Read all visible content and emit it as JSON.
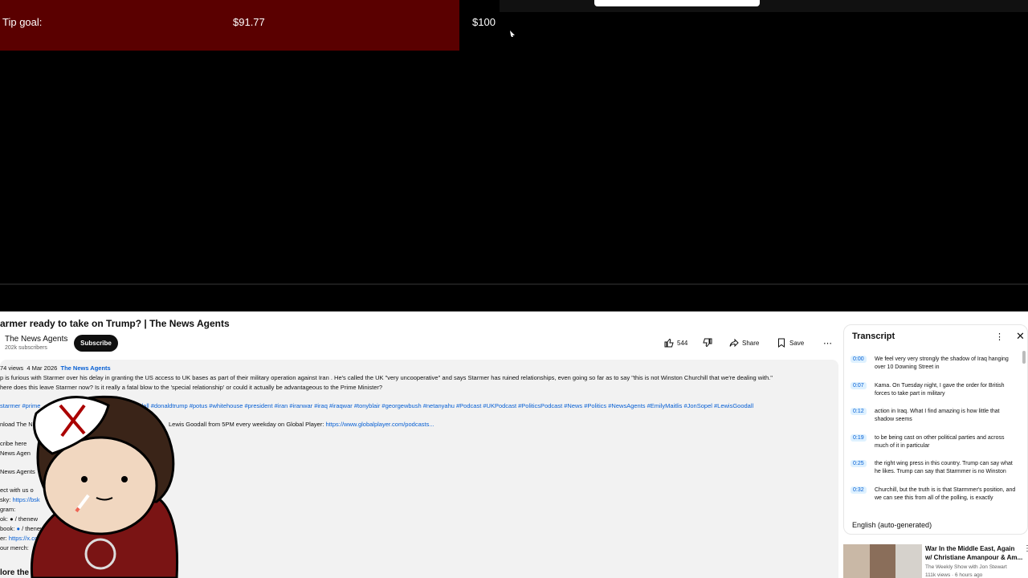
{
  "overlay": {
    "tip_label": "Tip goal:",
    "tip_current": "$91.77",
    "tip_goal": "$100",
    "tip_progress": 0.9177
  },
  "video": {
    "title": "armer ready to take on Trump? | The News Agents",
    "channel": "The News Agents",
    "subscribers": "202k subscribers",
    "subscribe_label": "Subscribe",
    "likes": "544",
    "share_label": "Share",
    "save_label": "Save",
    "more_label": "⋯"
  },
  "description": {
    "views": "74 views",
    "date": "4 Mar 2026",
    "channel_link": "The News Agents",
    "line1": "p is furious with Starmer over his delay in granting the US access to UK bases as part of their military operation against Iran . He's called the UK \"very uncooperative\" and says Starmer has ruined relationships, even going so far as to say \"this is not Winston Churchill that we're dealing with.\"",
    "line2": "here does this leave Starmer now? Is it really a fatal blow to the 'special relationship' or could it actually be advantageous to the Prime Minister?",
    "hashtags": "starmer #prime",
    "hashtags2": "dall #donaldtrump #potus #whitehouse #president #iran #iranwar #iraq #iraqwar #tonyblair #georgewbush #netanyahu  #Podcast #UKPodcast #PoliticsPodcast #News #Politics #NewsAgents #EmilyMaitlis #JonSopel #LewisGoodall",
    "download_prefix": "nload The N",
    "download_text": "Lewis Goodall from 5PM every weekday on Global Player:",
    "download_link": "https://www.globalplayer.com/podcasts...",
    "subscribe_line": "cribe here",
    "news_agents_line": "News Agen",
    "news_agents_line2": "News Agents",
    "connect_line": "ect with us o",
    "bluesky_line": "sky:",
    "bluesky_link": "https://bsk",
    "instagram_line": "gram:",
    "tiktok_line": "ok:",
    "tiktok_handle": "/ thenew",
    "facebook_line": "book:",
    "facebook_handle": "/ thenews",
    "x_line": "er:",
    "x_link": "https://x.co",
    "merch_line": "our merch:",
    "explore_line": "lore the podca"
  },
  "transcript": {
    "title": "Transcript",
    "language": "English (auto-generated)",
    "entries": [
      {
        "time": "0:00",
        "text": "We feel very very strongly the shadow of Iraq hanging over 10 Downing Street in"
      },
      {
        "time": "0:07",
        "text": "Kama. On Tuesday night, I gave the order for British forces to take part in military"
      },
      {
        "time": "0:12",
        "text": "action in Iraq. What I find amazing is how little that shadow seems"
      },
      {
        "time": "0:19",
        "text": "to be being cast on other political parties and across much of it in particular"
      },
      {
        "time": "0:25",
        "text": "the right wing press in this country. Trump can say what he likes. Trump can say that Starmmer is no Winston"
      },
      {
        "time": "0:32",
        "text": "Churchill, but the truth is is that Starmmer's position, and we can see this from all of the polling, is exactly"
      }
    ]
  },
  "recommendation": {
    "title": "War In the Middle East, Again w/ Christiane Amanpour & Am...",
    "channel": "The Weekly Show with Jon Stewart",
    "views": "111k views · 6 hours ago"
  }
}
